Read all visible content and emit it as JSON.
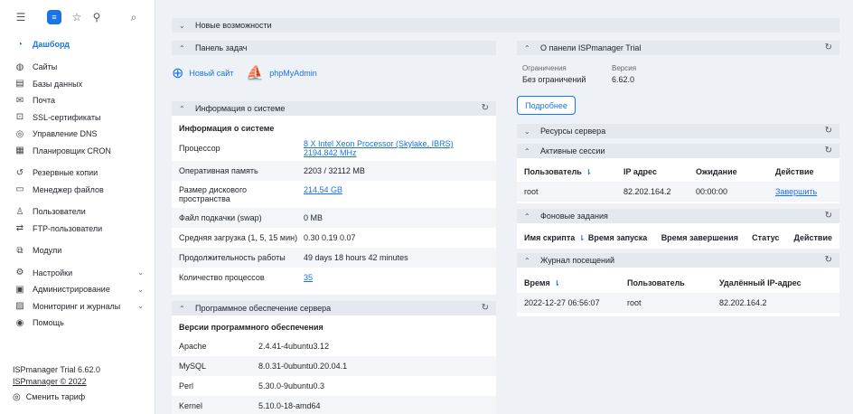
{
  "sidebar": {
    "items": [
      {
        "label": "Дашборд",
        "icon": "dashboard-icon",
        "glyph": "◔"
      },
      {
        "label": "Сайты",
        "icon": "globe-icon",
        "glyph": "◍"
      },
      {
        "label": "Базы данных",
        "icon": "database-icon",
        "glyph": "▤"
      },
      {
        "label": "Почта",
        "icon": "mail-icon",
        "glyph": "✉"
      },
      {
        "label": "SSL-сертификаты",
        "icon": "lock-icon",
        "glyph": "🔒"
      },
      {
        "label": "Управление DNS",
        "icon": "dns-icon",
        "glyph": "◎"
      },
      {
        "label": "Планировщик CRON",
        "icon": "calendar-icon",
        "glyph": "▦"
      },
      {
        "label": "Резервные копии",
        "icon": "backup-icon",
        "glyph": "↺"
      },
      {
        "label": "Менеджер файлов",
        "icon": "folder-icon",
        "glyph": "▭"
      },
      {
        "label": "Пользователи",
        "icon": "user-icon",
        "glyph": "♙"
      },
      {
        "label": "FTP-пользователи",
        "icon": "ftp-icon",
        "glyph": "⇄"
      },
      {
        "label": "Модули",
        "icon": "modules-icon",
        "glyph": "⧉"
      },
      {
        "label": "Настройки",
        "icon": "settings-icon",
        "glyph": "⚙"
      },
      {
        "label": "Администрирование",
        "icon": "admin-icon",
        "glyph": "▣"
      },
      {
        "label": "Мониторинг и журналы",
        "icon": "monitor-icon",
        "glyph": "▨"
      },
      {
        "label": "Помощь",
        "icon": "help-icon",
        "glyph": "◉"
      }
    ],
    "product": "ISPmanager Trial 6.62.0",
    "copyright": "ISPmanager © 2022",
    "change_tariff": "Сменить тариф"
  },
  "whats_new": {
    "title": "Новые возможности"
  },
  "taskbar": {
    "title": "Панель задач",
    "new_site": "Новый сайт",
    "phpmyadmin": "phpMyAdmin"
  },
  "sysinfo": {
    "title": "Информация о системе",
    "heading": "Информация о системе",
    "rows": [
      {
        "key": "Процессор",
        "value": "8 X Intel Xeon Processor (Skylake, IBRS) 2194.842 MHz"
      },
      {
        "key": "Оперативная память",
        "value": "2203 / 32112 MB"
      },
      {
        "key": "Размер дискового пространства",
        "value": "214.54 GB"
      },
      {
        "key": "Файл подкачки (swap)",
        "value": "0 MB"
      },
      {
        "key": "Средняя загрузка (1, 5, 15 мин)",
        "value": "0.30 0.19 0.07"
      },
      {
        "key": "Продолжительность работы",
        "value": "49 days 18 hours 42 minutes"
      },
      {
        "key": "Количество процессов",
        "value": "35"
      }
    ]
  },
  "software": {
    "title": "Программное обеспечение сервера",
    "heading": "Версии программного обеспечения",
    "rows": [
      {
        "name": "Apache",
        "version": "2.4.41-4ubuntu3.12"
      },
      {
        "name": "MySQL",
        "version": "8.0.31-0ubuntu0.20.04.1"
      },
      {
        "name": "Perl",
        "version": "5.30.0-9ubuntu0.3"
      },
      {
        "name": "Kernel",
        "version": "5.10.0-18-amd64"
      }
    ]
  },
  "about": {
    "title": "О панели ISPmanager Trial",
    "limits_label": "Ограничения",
    "limits_value": "Без ограничений",
    "version_label": "Версия",
    "version_value": "6.62.0",
    "more_button": "Подробнее"
  },
  "resources": {
    "title": "Ресурсы сервера"
  },
  "sessions": {
    "title": "Активные сессии",
    "headers": [
      "Пользователь",
      "IP адрес",
      "Ожидание",
      "Действие"
    ],
    "rows": [
      {
        "user": "root",
        "ip": "82.202.164.2",
        "idle": "00:00:00",
        "action": "Завершить"
      }
    ]
  },
  "background": {
    "title": "Фоновые задания",
    "headers": [
      "Имя скрипта",
      "Время запуска",
      "Время завершения",
      "Статус",
      "Действие"
    ]
  },
  "visits": {
    "title": "Журнал посещений",
    "headers": [
      "Время",
      "Пользователь",
      "Удалённый IP-адрес"
    ],
    "rows": [
      {
        "time": "2022-12-27 06:56:07",
        "user": "root",
        "ip": "82.202.164.2"
      }
    ]
  }
}
